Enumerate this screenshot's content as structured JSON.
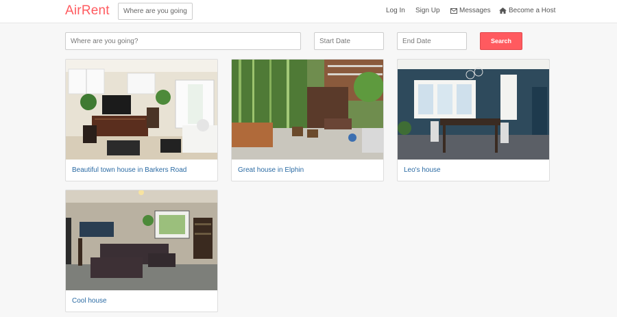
{
  "brand": {
    "name": "AirRent",
    "color": "#ff5a5f"
  },
  "nav": {
    "search_placeholder": "Where are you going?",
    "links": [
      {
        "label": "Log In",
        "icon": ""
      },
      {
        "label": "Sign Up",
        "icon": ""
      },
      {
        "label": "Messages",
        "icon": "envelope-icon"
      },
      {
        "label": "Become a Host",
        "icon": "home-icon"
      }
    ]
  },
  "search": {
    "location_placeholder": "Where are you going?",
    "start_placeholder": "Start Date",
    "end_placeholder": "End Date",
    "button_label": "Search"
  },
  "listings": [
    {
      "title": "Beautiful town house in Barkers Road",
      "photo": "living-room-photo"
    },
    {
      "title": "Great house in Elphin",
      "photo": "courtyard-photo"
    },
    {
      "title": "Leo's house",
      "photo": "dining-room-photo"
    },
    {
      "title": "Cool house",
      "photo": "lounge-photo"
    }
  ],
  "colors": {
    "accent": "#ff5a5f",
    "link": "#2a6aa3",
    "background": "#f7f7f7"
  }
}
